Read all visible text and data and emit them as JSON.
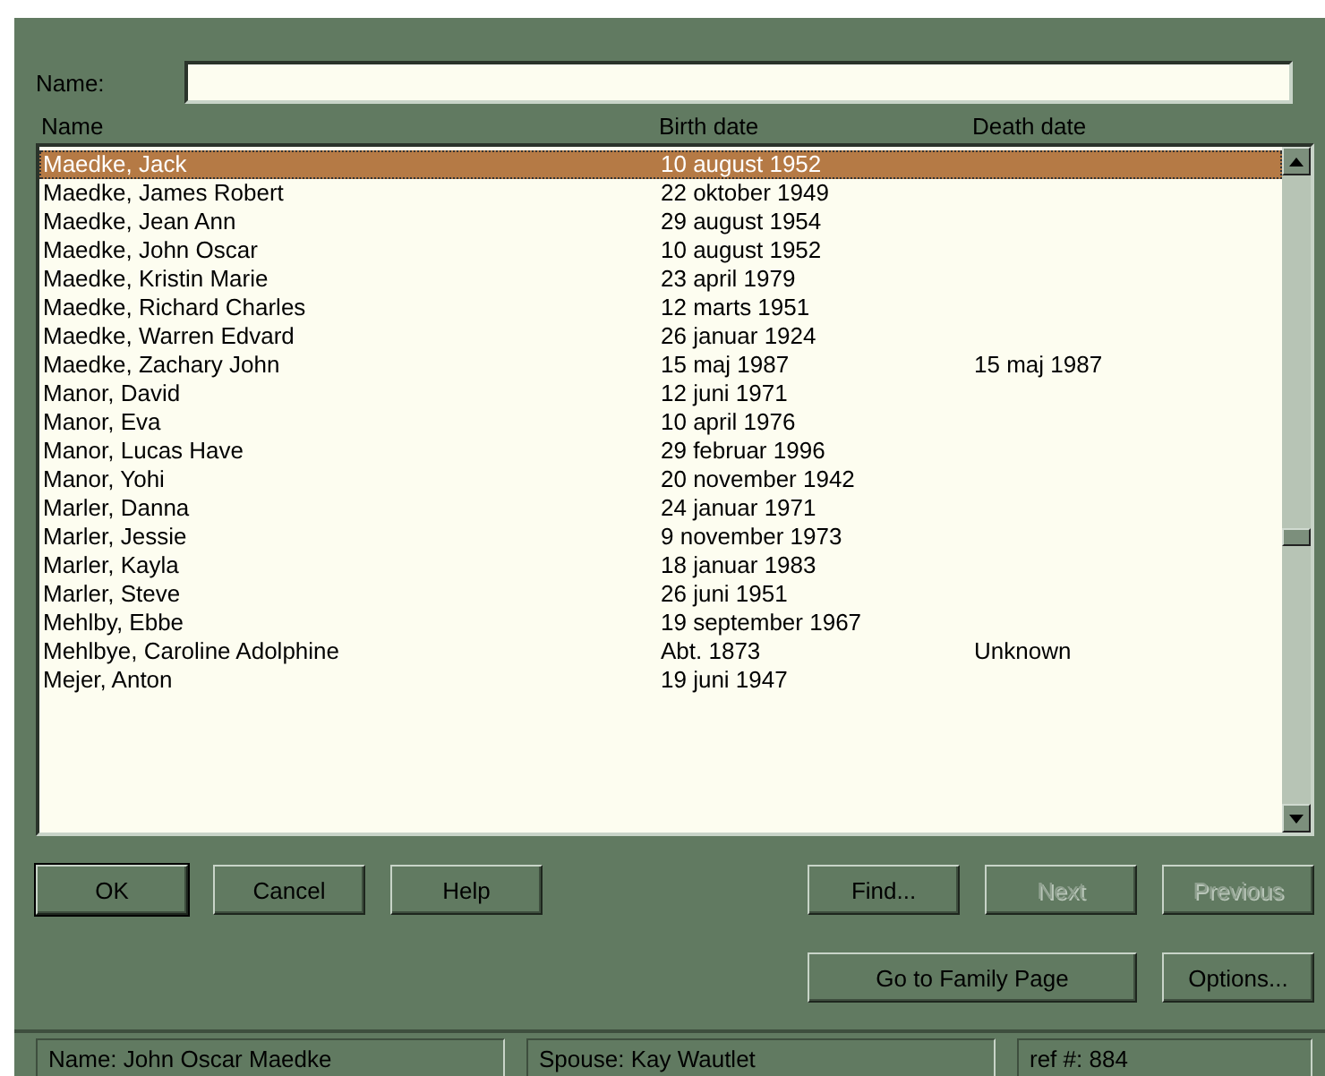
{
  "name_field": {
    "label": "Name:"
  },
  "columns": [
    "Name",
    "Birth date",
    "Death date"
  ],
  "rows": [
    {
      "name": "Maedke, Jack",
      "birth": "10 august 1952",
      "death": "",
      "selected": true
    },
    {
      "name": "Maedke, James Robert",
      "birth": "22 oktober 1949",
      "death": "",
      "selected": false
    },
    {
      "name": "Maedke, Jean Ann",
      "birth": "29 august 1954",
      "death": "",
      "selected": false
    },
    {
      "name": "Maedke, John Oscar",
      "birth": "10 august 1952",
      "death": "",
      "selected": false
    },
    {
      "name": "Maedke, Kristin Marie",
      "birth": "23 april 1979",
      "death": "",
      "selected": false
    },
    {
      "name": "Maedke, Richard Charles",
      "birth": "12 marts 1951",
      "death": "",
      "selected": false
    },
    {
      "name": "Maedke, Warren Edvard",
      "birth": "26 januar 1924",
      "death": "",
      "selected": false
    },
    {
      "name": "Maedke, Zachary John",
      "birth": "15 maj 1987",
      "death": "15 maj 1987",
      "selected": false
    },
    {
      "name": "Manor, David",
      "birth": "12 juni 1971",
      "death": "",
      "selected": false
    },
    {
      "name": "Manor, Eva",
      "birth": "10 april 1976",
      "death": "",
      "selected": false
    },
    {
      "name": "Manor, Lucas Have",
      "birth": "29 februar 1996",
      "death": "",
      "selected": false
    },
    {
      "name": "Manor, Yohi",
      "birth": "20 november 1942",
      "death": "",
      "selected": false
    },
    {
      "name": "Marler, Danna",
      "birth": "24 januar 1971",
      "death": "",
      "selected": false
    },
    {
      "name": "Marler, Jessie",
      "birth": "9 november 1973",
      "death": "",
      "selected": false
    },
    {
      "name": "Marler, Kayla",
      "birth": "18 januar 1983",
      "death": "",
      "selected": false
    },
    {
      "name": "Marler, Steve",
      "birth": "26 juni 1951",
      "death": "",
      "selected": false
    },
    {
      "name": "Mehlby, Ebbe",
      "birth": "19 september 1967",
      "death": "",
      "selected": false
    },
    {
      "name": "Mehlbye, Caroline Adolphine",
      "birth": "Abt. 1873",
      "death": "Unknown",
      "selected": false
    },
    {
      "name": "Mejer, Anton",
      "birth": "19 juni 1947",
      "death": "",
      "selected": false
    }
  ],
  "buttons_row1_left": [
    {
      "label": "OK",
      "disabled": false,
      "default": true
    },
    {
      "label": "Cancel",
      "disabled": false,
      "default": false
    },
    {
      "label": "Help",
      "disabled": false,
      "default": false
    }
  ],
  "buttons_row1_right": [
    {
      "label": "Find...",
      "disabled": false,
      "default": false
    },
    {
      "label": "Next",
      "disabled": true,
      "default": false
    },
    {
      "label": "Previous",
      "disabled": true,
      "default": false
    }
  ],
  "buttons_row2": [
    {
      "label": "Go to Family Page",
      "disabled": false,
      "default": false
    },
    {
      "label": "Options...",
      "disabled": false,
      "default": false
    }
  ],
  "status_bar": [
    "Name: John Oscar Maedke",
    "Spouse: Kay Wautlet",
    "ref #: 884"
  ]
}
